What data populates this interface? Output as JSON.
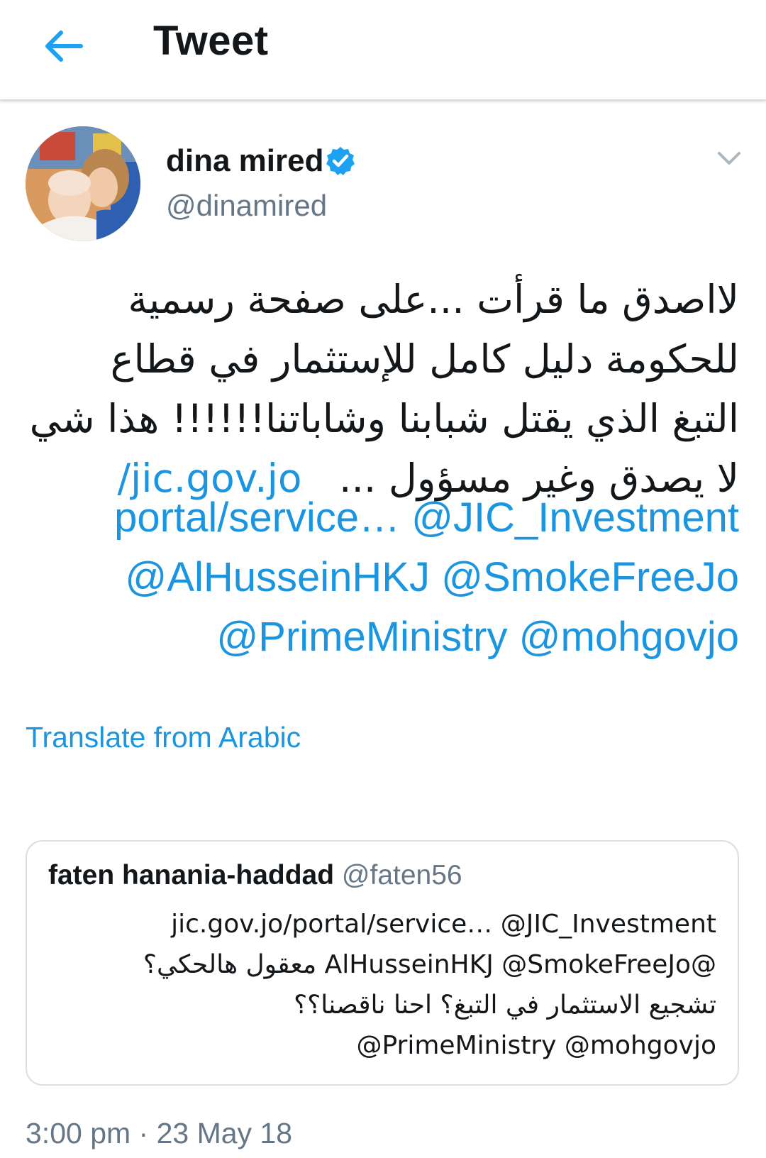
{
  "header": {
    "title": "Tweet"
  },
  "tweet": {
    "author_name": "dina mired",
    "author_handle": "@dinamired",
    "text_lines": [
      "لااصدق ما قرأت ...على صفحة رسمية",
      "للحكومة دليل كامل للإستثمار في قطاع",
      "التبغ الذي يقتل شبابنا وشاباتنا!!!!!!  هذا شي"
    ],
    "text_line4_arabic": "لا يصدق وغير مسؤول ...",
    "link_url_part1": "jic.gov.jo/",
    "link_url_part2": "portal/service…",
    "mentions": {
      "jic": "@JIC_Investment",
      "alhussein": "@AlHusseinHKJ",
      "smokefree": "@SmokeFreeJo",
      "primeministry": "@PrimeMinistry",
      "moh": "@mohgovjo"
    },
    "translate_label": "Translate from Arabic",
    "timestamp": "3:00 pm · 23 May 18"
  },
  "quoted_tweet": {
    "author_name": "faten hanania-haddad",
    "author_handle": "@faten56",
    "line1": "jic.gov.jo/portal/service… @JIC_Investment",
    "line2": "@AlHusseinHKJ @SmokeFreeJo معقول هالحكي؟",
    "line3": "تشجيع الاستثمار في التبغ؟ احنا ناقصنا؟؟",
    "line4": "@PrimeMinistry @mohgovjo"
  },
  "colors": {
    "link": "#1b95e0",
    "secondary_text": "#657786",
    "primary_text": "#14171a",
    "verified_badge": "#1da1f2"
  },
  "icons": {
    "back": "back-arrow-icon",
    "verified": "verified-badge-icon",
    "more": "chevron-down-icon"
  }
}
